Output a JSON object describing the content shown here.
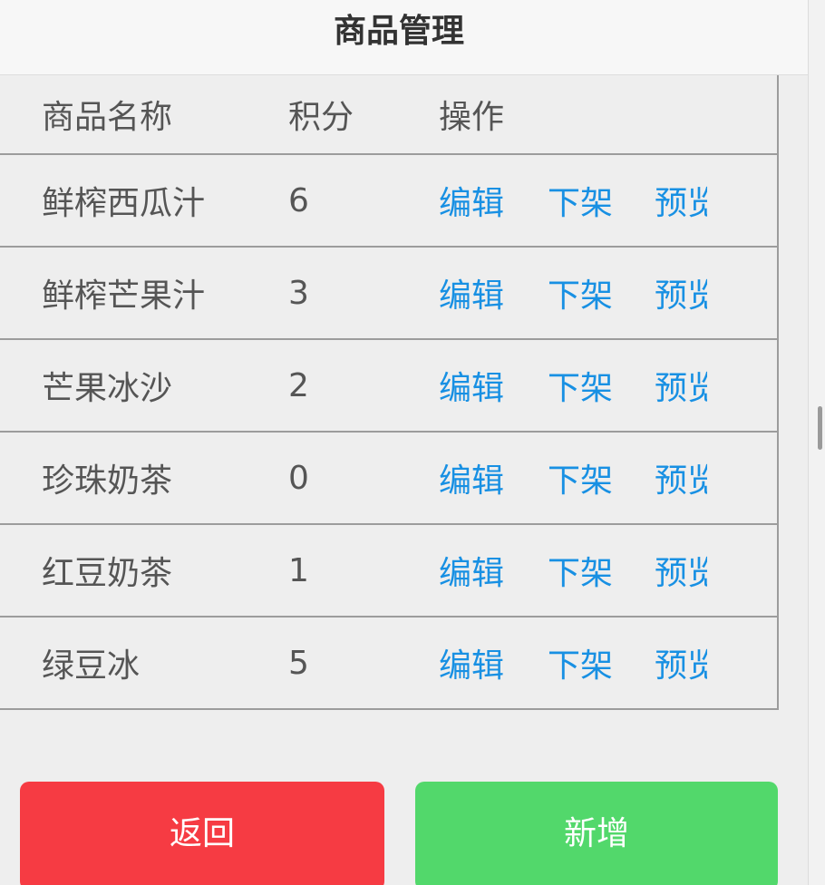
{
  "header": {
    "title": "商品管理"
  },
  "table": {
    "columns": [
      "商品名称",
      "积分",
      "操作"
    ],
    "rows": [
      {
        "name": "鲜榨西瓜汁",
        "points": "6",
        "edit": "编辑",
        "off_shelf": "下架",
        "preview": "预览"
      },
      {
        "name": "鲜榨芒果汁",
        "points": "3",
        "edit": "编辑",
        "off_shelf": "下架",
        "preview": "预览"
      },
      {
        "name": "芒果冰沙",
        "points": "2",
        "edit": "编辑",
        "off_shelf": "下架",
        "preview": "预览"
      },
      {
        "name": "珍珠奶茶",
        "points": "0",
        "edit": "编辑",
        "off_shelf": "下架",
        "preview": "预览"
      },
      {
        "name": "红豆奶茶",
        "points": "1",
        "edit": "编辑",
        "off_shelf": "下架",
        "preview": "预览"
      },
      {
        "name": "绿豆冰",
        "points": "5",
        "edit": "编辑",
        "off_shelf": "下架",
        "preview": "预览"
      }
    ]
  },
  "buttons": {
    "back_label": "返回",
    "add_label": "新增"
  },
  "colors": {
    "link": "#1890e3",
    "back_button": "#f63b43",
    "add_button": "#52d86b"
  }
}
